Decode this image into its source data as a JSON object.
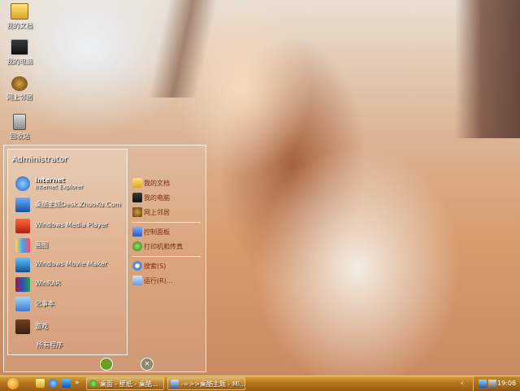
{
  "desktop_icons": [
    {
      "label": "我的文档",
      "icon": "my-documents-icon"
    },
    {
      "label": "我的电脑",
      "icon": "my-computer-icon"
    },
    {
      "label": "网上邻居",
      "icon": "network-icon"
    },
    {
      "label": "回收站",
      "icon": "recycle-bin-icon"
    }
  ],
  "start_menu": {
    "user_name": "Administrator",
    "pinned": [
      {
        "title": "Internet",
        "subtitle": "Internet Explorer",
        "icon": "ie-icon"
      },
      {
        "title": "桌酷主题Desk.ZhuoKu.Com",
        "subtitle": "",
        "icon": "zhuoku-icon"
      }
    ],
    "programs": [
      {
        "label": "Windows Media Player",
        "icon": "media-player-icon"
      },
      {
        "label": "画图",
        "icon": "paint-icon"
      },
      {
        "label": "Windows Movie Maker",
        "icon": "movie-maker-icon"
      },
      {
        "label": "WinRAR",
        "icon": "winrar-icon"
      },
      {
        "label": "记事本",
        "icon": "notepad-icon"
      },
      {
        "label": "游戏",
        "icon": "game-icon"
      }
    ],
    "all_programs": "所有程序",
    "right_items": [
      {
        "label": "我的文档",
        "icon": "my-documents-icon"
      },
      {
        "label": "我的电脑",
        "icon": "my-computer-icon"
      },
      {
        "label": "网上邻居",
        "icon": "network-icon"
      },
      {
        "label": "控制面板",
        "icon": "control-panel-icon"
      },
      {
        "label": "打印机和传真",
        "icon": "printer-icon"
      },
      {
        "label": "搜索(S)",
        "icon": "search-icon"
      },
      {
        "label": "运行(R)...",
        "icon": "run-icon"
      }
    ]
  },
  "taskbar": {
    "tasks": [
      {
        "label": "桌面 - 壁纸 - 桌酷...",
        "icon": "window-icon"
      },
      {
        "label": "-=>>桌酷主题 - Mi...",
        "icon": "document-icon"
      }
    ],
    "clock": "19:08"
  },
  "colors": {
    "taskbar": "#b5761c",
    "menu_text": "#7a2e10"
  }
}
